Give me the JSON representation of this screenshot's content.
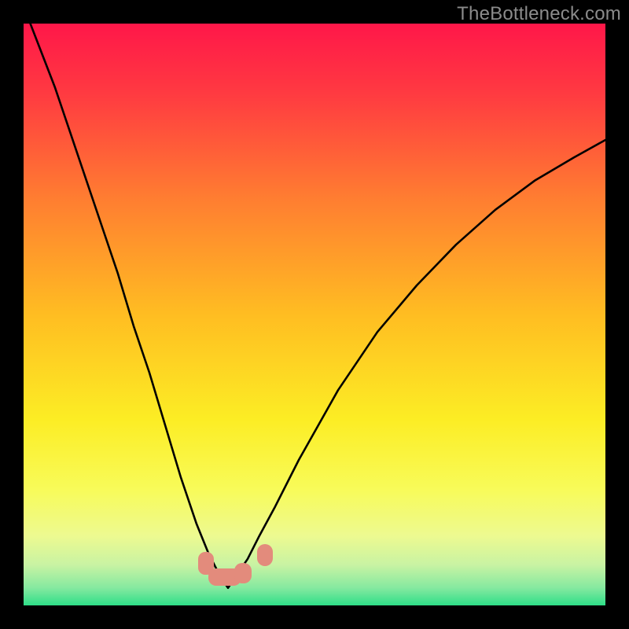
{
  "watermark": "TheBottleneck.com",
  "chart_data": {
    "type": "line",
    "title": "",
    "xlabel": "",
    "ylabel": "",
    "xlim": [
      0,
      740
    ],
    "ylim_pct": [
      0,
      100
    ],
    "gradient_stops": [
      {
        "pct": 0,
        "color": "#ff1749"
      },
      {
        "pct": 12,
        "color": "#ff3a41"
      },
      {
        "pct": 30,
        "color": "#ff7d31"
      },
      {
        "pct": 50,
        "color": "#ffbd22"
      },
      {
        "pct": 68,
        "color": "#fced24"
      },
      {
        "pct": 80,
        "color": "#f8fb59"
      },
      {
        "pct": 88,
        "color": "#edfa90"
      },
      {
        "pct": 93,
        "color": "#c9f3a3"
      },
      {
        "pct": 97,
        "color": "#85e9a0"
      },
      {
        "pct": 100,
        "color": "#2ede88"
      }
    ],
    "comment": "y_pct is percentage of plot height from the top (0 = top, 100 = bottom). Curve is a sharp V/U shaped dip with minimum near x≈260, right branch rises more slowly than left.",
    "series": [
      {
        "name": "dip-curve",
        "x": [
          0,
          20,
          40,
          60,
          80,
          100,
          120,
          140,
          160,
          180,
          200,
          220,
          235,
          250,
          260,
          270,
          285,
          300,
          320,
          350,
          400,
          450,
          500,
          550,
          600,
          650,
          700,
          740
        ],
        "y_pct": [
          -3,
          4,
          11,
          19,
          27,
          35,
          43,
          52,
          60,
          69,
          78,
          86,
          91,
          95,
          97,
          95,
          92,
          88,
          83,
          75,
          63,
          53,
          45,
          38,
          32,
          27,
          23,
          20
        ]
      }
    ],
    "bumps": [
      {
        "x": 232,
        "y_pct": 92,
        "label": "bump-left"
      },
      {
        "x": 256,
        "y_pct": 95,
        "label": "bump-mid"
      },
      {
        "x": 279,
        "y_pct": 94,
        "label": "bump-right-low"
      },
      {
        "x": 307,
        "y_pct": 91,
        "label": "bump-right-high"
      }
    ]
  }
}
